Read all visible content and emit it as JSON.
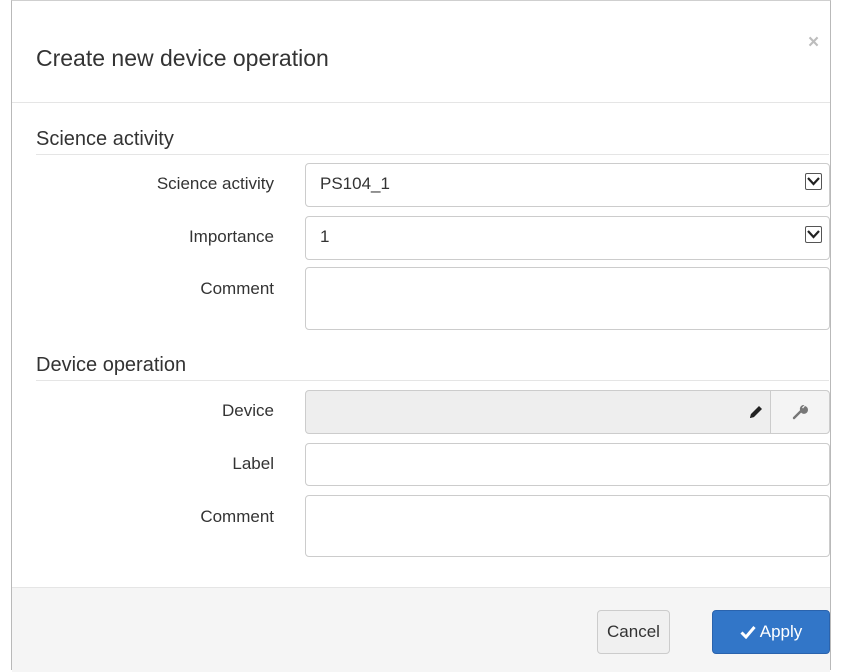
{
  "dialog": {
    "title": "Create new device operation",
    "close_symbol": "×"
  },
  "science_section": {
    "title": "Science activity",
    "science_activity_label": "Science activity",
    "science_activity_value": "PS104_1",
    "importance_label": "Importance",
    "importance_value": "1",
    "comment_label": "Comment",
    "comment_value": ""
  },
  "device_section": {
    "title": "Device operation",
    "device_label": "Device",
    "device_value": "",
    "label_label": "Label",
    "label_value": "",
    "comment_label": "Comment",
    "comment_value": ""
  },
  "footer": {
    "cancel_label": "Cancel",
    "apply_label": "Apply"
  },
  "icons": {
    "dropdown": "chevron-down-icon",
    "edit": "pencil-icon",
    "tool": "wrench-icon",
    "apply": "checkmark-icon"
  },
  "colors": {
    "primary": "#3276c8",
    "footer_bg": "#f5f5f5"
  }
}
